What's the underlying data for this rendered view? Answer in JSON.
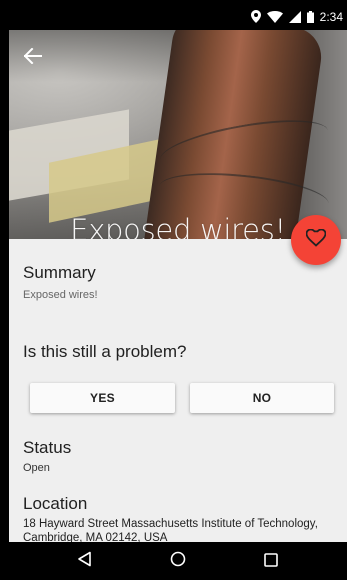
{
  "status_bar": {
    "time": "2:34",
    "icons": [
      "location-pin-icon",
      "wifi-icon",
      "cell-signal-icon",
      "battery-icon"
    ]
  },
  "hero": {
    "title": "Exposed wires!",
    "back_icon": "arrow-left-icon"
  },
  "fab": {
    "icon": "heart-outline-icon",
    "color": "#f44336"
  },
  "summary": {
    "heading": "Summary",
    "text": "Exposed wires!"
  },
  "problem": {
    "question": "Is this still a problem?",
    "yes_label": "YES",
    "no_label": "NO"
  },
  "status": {
    "heading": "Status",
    "value": "Open"
  },
  "location": {
    "heading": "Location",
    "address": "18 Hayward Street Massachusetts Institute of Technology, Cambridge, MA 02142, USA"
  },
  "nav_bar": {
    "icons": [
      "back-triangle-icon",
      "home-circle-icon",
      "recents-square-icon"
    ]
  }
}
